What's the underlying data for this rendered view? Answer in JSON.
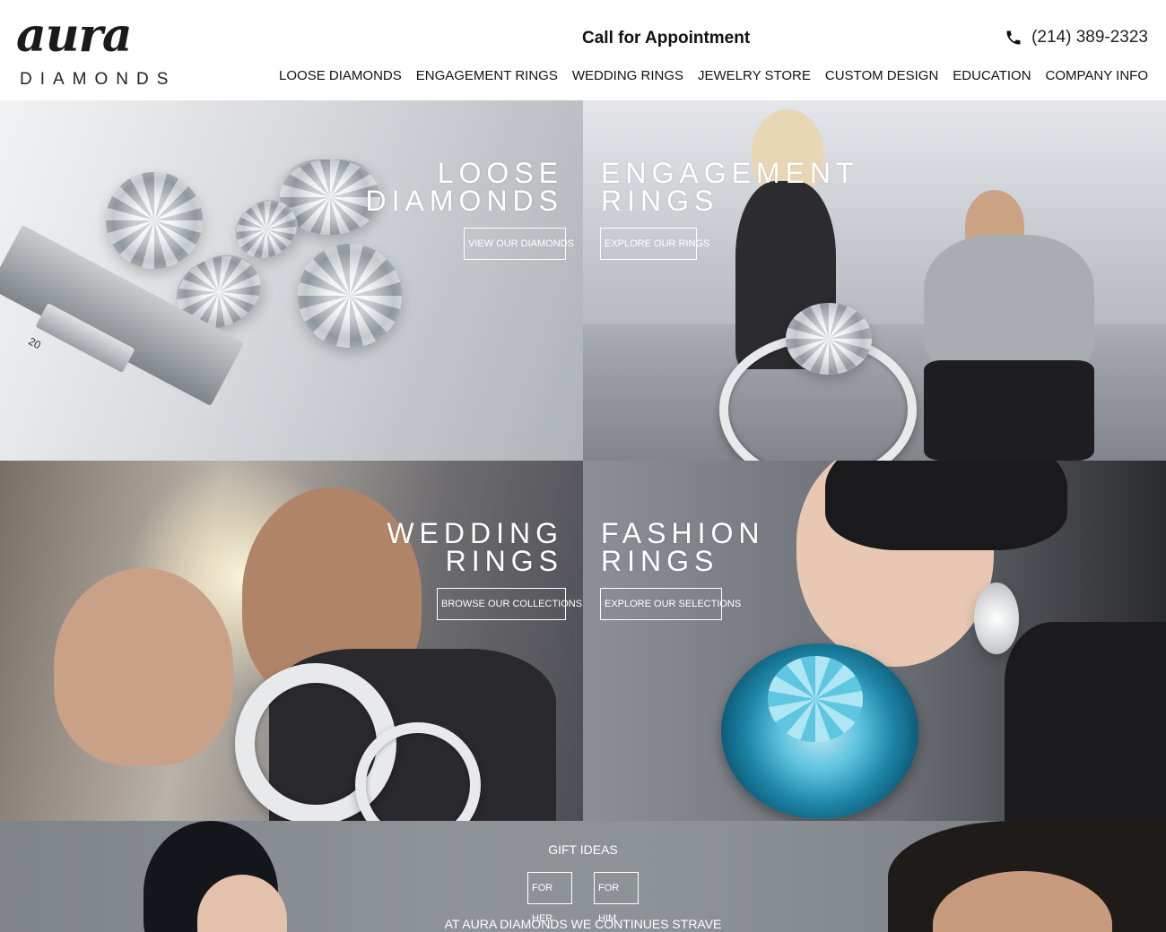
{
  "brand": {
    "logo_script": "aura",
    "logo_sub": "DIAMONDS"
  },
  "header": {
    "appointment": "Call for Appointment",
    "phone": "(214) 389-2323"
  },
  "nav": {
    "items": [
      {
        "label": "LOOSE DIAMONDS"
      },
      {
        "label": "ENGAGEMENT RINGS"
      },
      {
        "label": "WEDDING RINGS"
      },
      {
        "label": "JEWELRY STORE"
      },
      {
        "label": "CUSTOM DESIGN"
      },
      {
        "label": "EDUCATION"
      },
      {
        "label": "COMPANY INFO"
      }
    ]
  },
  "tiles": [
    {
      "title_line1": "LOOSE",
      "title_line2": "DIAMONDS",
      "button": "VIEW OUR DIAMONDS"
    },
    {
      "title_line1": "ENGAGEMENT",
      "title_line2": "RINGS",
      "button": "EXPLORE OUR RINGS"
    },
    {
      "title_line1": "WEDDING",
      "title_line2": "RINGS",
      "button": "BROWSE OUR COLLECTIONS"
    },
    {
      "title_line1": "FASHION",
      "title_line2": "RINGS",
      "button": "EXPLORE OUR SELECTIONS"
    }
  ],
  "gifts": {
    "title": "GIFT IDEAS",
    "for_her": "FOR HER",
    "for_him": "FOR HIM",
    "text": "AT AURA DIAMONDS WE CONTINUES STRAVE"
  },
  "decor": {
    "caliper_mark": "20"
  },
  "colors": {
    "text": "#111111",
    "overlay_text": "#ffffff",
    "accent_gem": "#3aa7c9"
  }
}
